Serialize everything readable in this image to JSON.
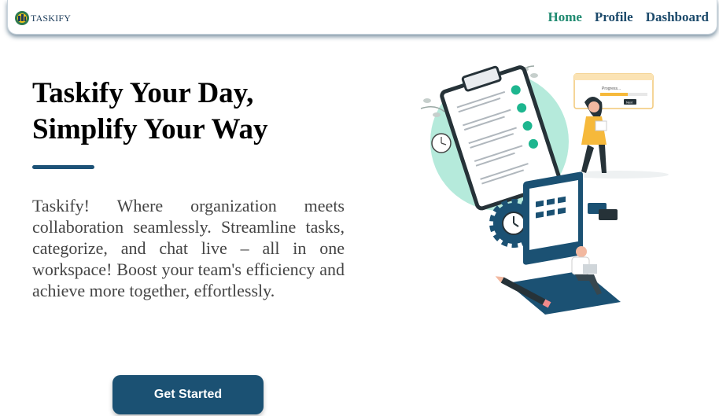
{
  "brand": {
    "name": "TASKIFY",
    "logo_icon": "taskify-logo-icon"
  },
  "nav": {
    "links": [
      {
        "label": "Home",
        "active": true
      },
      {
        "label": "Profile",
        "active": false
      },
      {
        "label": "Dashboard",
        "active": false
      }
    ]
  },
  "hero": {
    "title_line1": "Taskify Your Day,",
    "title_line2": "Simplify Your Way",
    "description": "Taskify! Where organization meets collaboration seamlessly. Streamline tasks, categorize, and chat live – all in one workspace! Boost your team's efficiency and achieve more together, effortlessly.",
    "cta_label": "Get Started"
  },
  "illustration": {
    "progress_label": "Progress...",
    "small_button_label": "Next"
  },
  "colors": {
    "primary": "#1b5173",
    "active_nav": "#1f8a70",
    "mint": "#b5eadb",
    "accent_yellow": "#f6b93b"
  }
}
